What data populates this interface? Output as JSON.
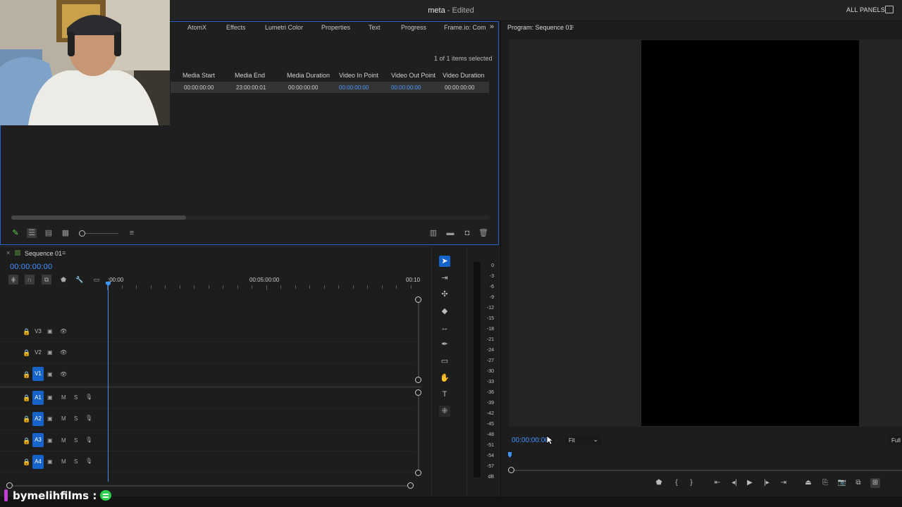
{
  "app": {
    "title": "meta",
    "status": "- Edited",
    "all_panels": "ALL PANELS"
  },
  "project_panel": {
    "tabs": [
      "AtomX",
      "Effects",
      "Lumetri Color",
      "Properties",
      "Text",
      "Progress",
      "Frame.io: Comm"
    ],
    "overflow": "»",
    "selection_count": "1 of 1 items selected",
    "columns": [
      "Media Start",
      "Media End",
      "Media Duration",
      "Video In Point",
      "Video Out Point",
      "Video Duration"
    ],
    "row": [
      "00:00:00:00",
      "23:00:00:01",
      "00:00:00:00",
      "00:00:00:00",
      "00:00:00:00",
      "00:00:00:00"
    ]
  },
  "timeline": {
    "close": "×",
    "title": "Sequence 01",
    "menu": "≡",
    "timecode": "00:00:00:00",
    "ruler_labels": [
      ":00:00",
      "00:05:00:00",
      "00:10"
    ],
    "video_tracks": [
      "V3",
      "V2",
      "V1"
    ],
    "audio_tracks": [
      "A1",
      "A2",
      "A3",
      "A4"
    ],
    "mute_label": "M",
    "solo_label": "S"
  },
  "audio_meter": {
    "labels": [
      "0",
      "-3",
      "-6",
      "-9",
      "-12",
      "-15",
      "-18",
      "-21",
      "-24",
      "-27",
      "-30",
      "-33",
      "-36",
      "-39",
      "-42",
      "-45",
      "-48",
      "-51",
      "-54",
      "-57",
      "dB"
    ]
  },
  "program_monitor": {
    "title": "Program: Sequence 01",
    "menu": "≡",
    "timecode": "00:00:00:00",
    "zoom": "Fit",
    "resolution": "Full"
  },
  "overlay": {
    "handle": "bymelihfilms :"
  },
  "colors": {
    "accent": "#1663c9",
    "timecode_blue": "#3e94ff",
    "panel_border": "#2a64c8"
  }
}
